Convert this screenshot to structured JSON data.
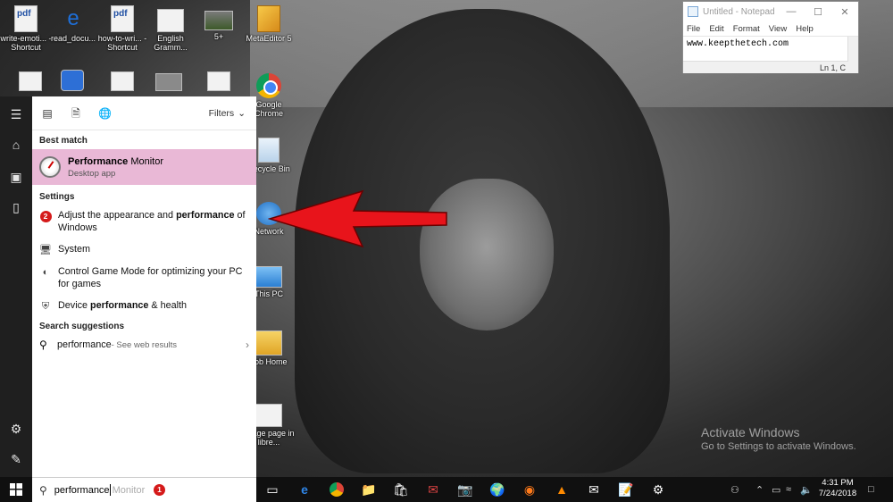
{
  "desktop_icons": [
    {
      "label": "write-emoti... - Shortcut",
      "icon": "pdf-file-icon"
    },
    {
      "label": "read_docu...",
      "icon": "edge-file-icon"
    },
    {
      "label": "how-to-wri... - Shortcut",
      "icon": "pdf-file-icon"
    },
    {
      "label": "English Gramm...",
      "icon": "document-icon"
    },
    {
      "label": "5+",
      "icon": "image-icon"
    },
    {
      "label": "MetaEditor 5",
      "icon": "metaeditor-icon"
    },
    {
      "label": "Google Chrome",
      "icon": "chrome-icon"
    },
    {
      "label": "Recycle Bin",
      "icon": "recycle-bin-icon"
    },
    {
      "label": "Network",
      "icon": "network-icon"
    },
    {
      "label": "This PC",
      "icon": "this-pc-icon"
    },
    {
      "label": "Job Home",
      "icon": "folder-icon"
    },
    {
      "label": "Image page in libre...",
      "icon": "document-icon"
    }
  ],
  "notepad": {
    "title": "Untitled - Notepad",
    "menu": [
      "File",
      "Edit",
      "Format",
      "View",
      "Help"
    ],
    "content": "www.keepthetech.com",
    "status": "Ln 1, C"
  },
  "watermark": {
    "line1": "Activate Windows",
    "line2": "Go to Settings to activate Windows."
  },
  "search_panel": {
    "filters_label": "Filters",
    "best_match_heading": "Best match",
    "best_match": {
      "name_bold": "Performance",
      "name_rest": " Monitor",
      "subtitle": "Desktop app"
    },
    "settings_heading": "Settings",
    "settings_items": [
      {
        "pre": "Adjust the appearance and ",
        "bold": "performance",
        "post": " of Windows",
        "icon": "badge-2"
      },
      {
        "pre": "System",
        "bold": "",
        "post": "",
        "icon": "monitor-icon"
      },
      {
        "pre": "Control Game Mode for optimizing your PC for games",
        "bold": "",
        "post": "",
        "icon": "game-mode-icon"
      },
      {
        "pre": "Device ",
        "bold": "performance",
        "post": " & health",
        "icon": "shield-icon"
      }
    ],
    "suggestions_heading": "Search suggestions",
    "suggestion": {
      "term": "performance",
      "hint": " - See web results"
    }
  },
  "searchbox": {
    "typed": "performance",
    "ghost": "Monitor"
  },
  "badges": {
    "one": "1",
    "two": "2"
  },
  "clock": {
    "time": "4:31 PM",
    "date": "7/24/2018"
  },
  "colors": {
    "best_match_highlight": "#e9b8d6",
    "badge_red": "#d51a1a",
    "arrow_red": "#e8141b",
    "taskbar": "#101010",
    "rail": "#1f1f1f"
  }
}
